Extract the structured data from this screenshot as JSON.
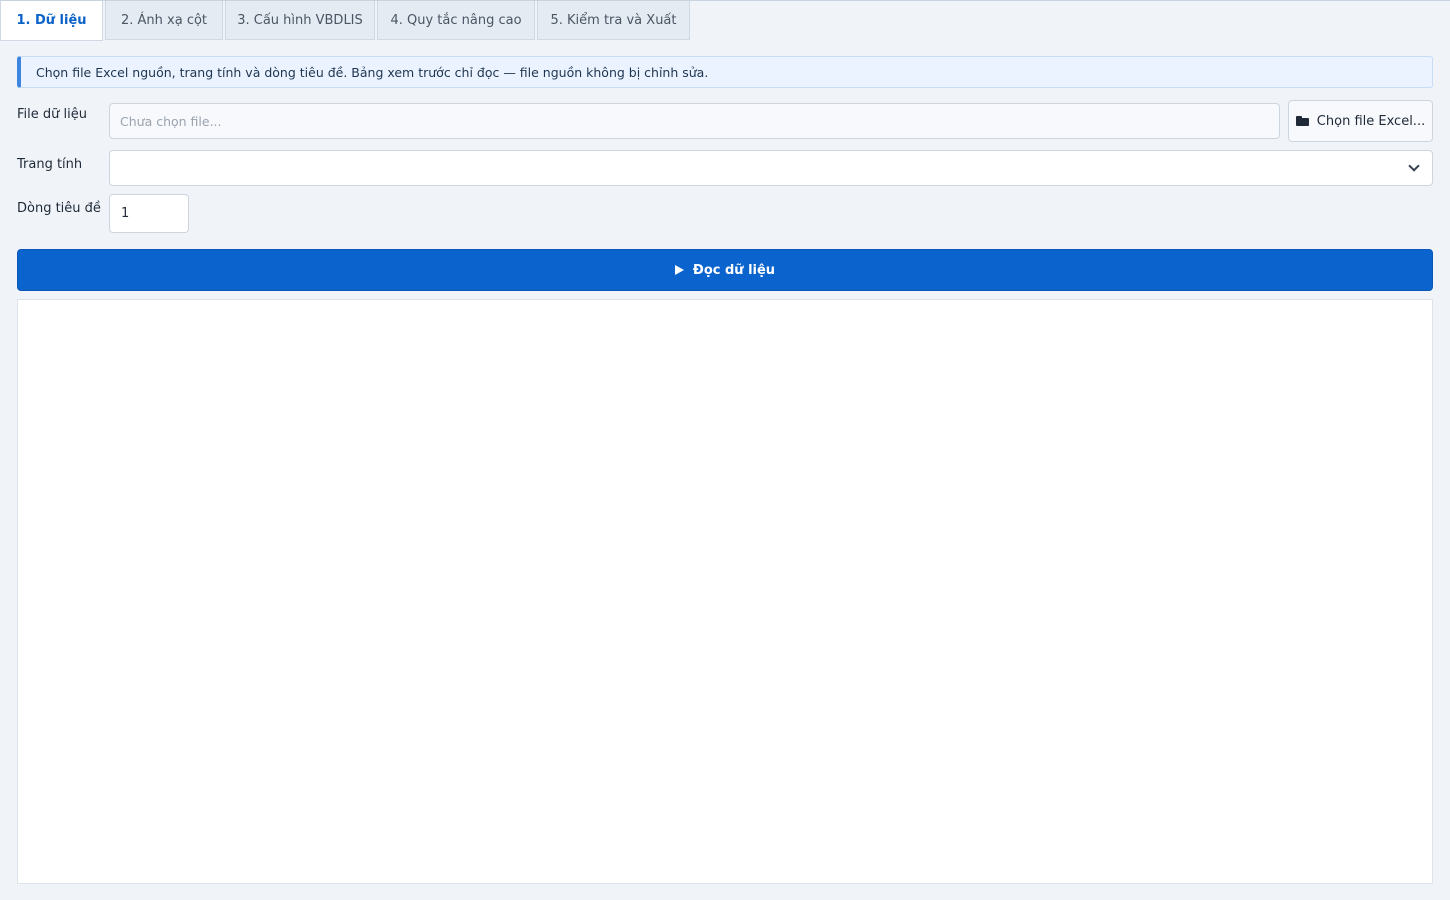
{
  "tabs": [
    {
      "label": "1. Dữ liệu",
      "active": true
    },
    {
      "label": "2. Ánh xạ cột",
      "active": false
    },
    {
      "label": "3. Cấu hình VBDLIS",
      "active": false
    },
    {
      "label": "4. Quy tắc nâng cao",
      "active": false
    },
    {
      "label": "5. Kiểm tra và Xuất",
      "active": false
    }
  ],
  "info": {
    "text": "Chọn file Excel nguồn, trang tính và dòng tiêu đề. Bảng xem trước chỉ đọc — file nguồn không bị chỉnh sửa."
  },
  "form": {
    "file_label": "File dữ liệu",
    "file_placeholder": "Chưa chọn file...",
    "file_value": "",
    "pick_button_label": "Chọn file Excel...",
    "pick_button_icon": "folder-icon",
    "sheet_label": "Trang tính",
    "sheet_value": "",
    "header_row_label": "Dòng tiêu đề",
    "header_row_value": "1"
  },
  "actions": {
    "read_label": "Đọc dữ liệu",
    "read_icon": "play-icon"
  },
  "colors": {
    "accent": "#0b63ce",
    "active_tab_text": "#0b63c9",
    "info_border": "#3d86e0",
    "background": "#f0f4f9"
  }
}
